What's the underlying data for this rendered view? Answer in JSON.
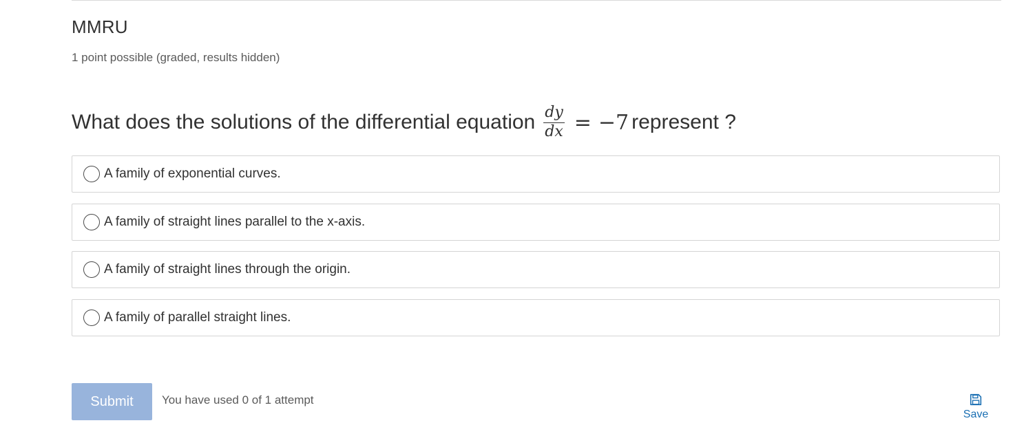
{
  "problem": {
    "title": "MMRU",
    "points": "1 point possible (graded, results hidden)",
    "question": {
      "before": "What does the solutions of the differential equation",
      "math": {
        "numerator": "dy",
        "denominator": "dx",
        "equals": "=",
        "rhs": "−7"
      },
      "after": "represent ?"
    },
    "choices": [
      {
        "label": "A family of exponential curves.",
        "selected": false
      },
      {
        "label": "A family of straight lines parallel to the x-axis.",
        "selected": false
      },
      {
        "label": "A family of straight lines through the origin.",
        "selected": false
      },
      {
        "label": "A family of parallel straight lines.",
        "selected": false
      }
    ]
  },
  "actions": {
    "submit_label": "Submit",
    "attempts_text": "You have used 0 of 1 attempt",
    "save_label": "Save",
    "save_icon": "floppy-disk-icon"
  },
  "colors": {
    "submit_bg": "#98b4dc",
    "link": "#1a6fb3",
    "text": "#313131",
    "border": "#d4d4d4"
  }
}
